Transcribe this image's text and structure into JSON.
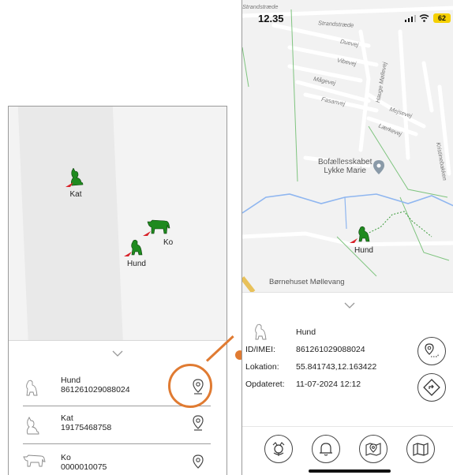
{
  "left": {
    "markers": [
      {
        "label": "Kat",
        "animal": "cat-icon"
      },
      {
        "label": "Ko",
        "animal": "cow-icon"
      },
      {
        "label": "Hund",
        "animal": "dog-icon"
      }
    ],
    "list": [
      {
        "name": "Hund",
        "id": "861261029088024"
      },
      {
        "name": "Kat",
        "id": "19175468758"
      },
      {
        "name": "Ko",
        "id": "0000010075"
      }
    ]
  },
  "right": {
    "status": {
      "time": "12.35",
      "battery": "62"
    },
    "streets": [
      "Strandstræde",
      "Duevej",
      "Vibevej",
      "Mågevej",
      "Fasanvej",
      "Hauge Møllevej",
      "Mejsevej",
      "Lærkevej",
      "Kristinebakken",
      "Strandstræde"
    ],
    "poi": {
      "line1": "Bofællesskabet",
      "line2": "Lykke Marie",
      "bottom": "Børnehuset Møllevang"
    },
    "marker_label": "Hund",
    "details": {
      "name": "Hund",
      "id_label": "ID/IMEI:",
      "id_value": "861261029088024",
      "loc_label": "Lokation:",
      "loc_value": "55.841743,12.163422",
      "upd_label": "Opdateret:",
      "upd_value": "11-07-2024 12:12"
    },
    "tabs": [
      "animals-tab-icon",
      "alarm-bell-icon",
      "geofence-map-icon",
      "map-icon"
    ]
  },
  "colors": {
    "accent": "#e07b32",
    "marker_green": "#1f8a1f",
    "pin_red": "#d8232a",
    "water": "#8fb6f0",
    "green_line": "#7fc47f"
  }
}
